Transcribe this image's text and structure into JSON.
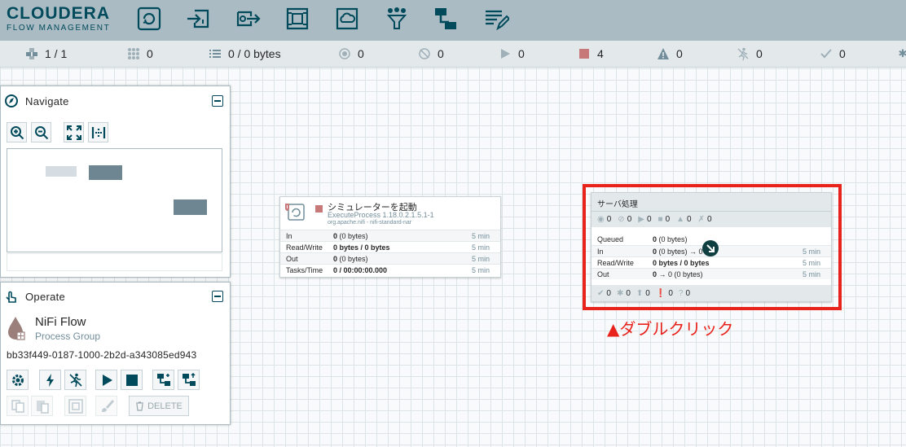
{
  "brand": {
    "name": "CLOUDERA",
    "sub": "FLOW MANAGEMENT"
  },
  "toolbar": {
    "tools": [
      "processor-icon",
      "input-port-icon",
      "output-port-icon",
      "process-group-icon",
      "remote-process-group-icon",
      "funnel-icon",
      "template-icon",
      "label-icon"
    ]
  },
  "status": {
    "cluster": "1 / 1",
    "threads": "0",
    "queued": "0 / 0 bytes",
    "transmitting": "0",
    "not_transmitting": "0",
    "running": "0",
    "stopped": "4",
    "invalid": "0",
    "disabled": "0",
    "up_to_date": "0"
  },
  "navigate": {
    "title": "Navigate"
  },
  "operate": {
    "title": "Operate",
    "name": "NiFi Flow",
    "type": "Process Group",
    "id": "bb33f449-0187-1000-2b2d-a343085ed943",
    "delete_label": "DELETE"
  },
  "processor": {
    "name": "シミュレーターを起動",
    "type": "ExecuteProcess 1.18.0.2.1.5.1-1",
    "bundle": "org.apache.nifi - nifi-standard-nar",
    "rows": [
      {
        "label": "In",
        "value_bold": "0",
        "value_rest": " (0 bytes)",
        "time": "5 min"
      },
      {
        "label": "Read/Write",
        "value_bold": "0 bytes / 0 bytes",
        "value_rest": "",
        "time": "5 min"
      },
      {
        "label": "Out",
        "value_bold": "0",
        "value_rest": " (0 bytes)",
        "time": "5 min"
      },
      {
        "label": "Tasks/Time",
        "value_bold": "0 / 00:00:00.000",
        "value_rest": "",
        "time": "5 min"
      }
    ]
  },
  "process_group": {
    "name": "サーバ処理",
    "stats": {
      "transmitting": "0",
      "not_transmitting": "0",
      "running": "0",
      "stopped": "0",
      "invalid": "0",
      "disabled": "0"
    },
    "rows": [
      {
        "label": "Queued",
        "value_bold": "0",
        "value_rest": " (0 bytes)",
        "time": ""
      },
      {
        "label": "In",
        "value_bold": "0",
        "value_rest": " (0 bytes) → 0",
        "time": "5 min"
      },
      {
        "label": "Read/Write",
        "value_bold": "0 bytes / 0 bytes",
        "value_rest": "",
        "time": "5 min"
      },
      {
        "label": "Out",
        "value_bold": "0",
        "value_rest": " → 0 (0 bytes)",
        "time": "5 min"
      }
    ],
    "footer": {
      "up_to_date": "0",
      "locally_modified": "0",
      "stale": "0",
      "modified_stale": "0",
      "sync_failure": "0"
    }
  },
  "annotation": "▲ダブルクリック",
  "colors": {
    "header": "#aabbc3",
    "brand": "#004a5c",
    "annotation": "#e8231c",
    "stopped": "#c77878"
  }
}
